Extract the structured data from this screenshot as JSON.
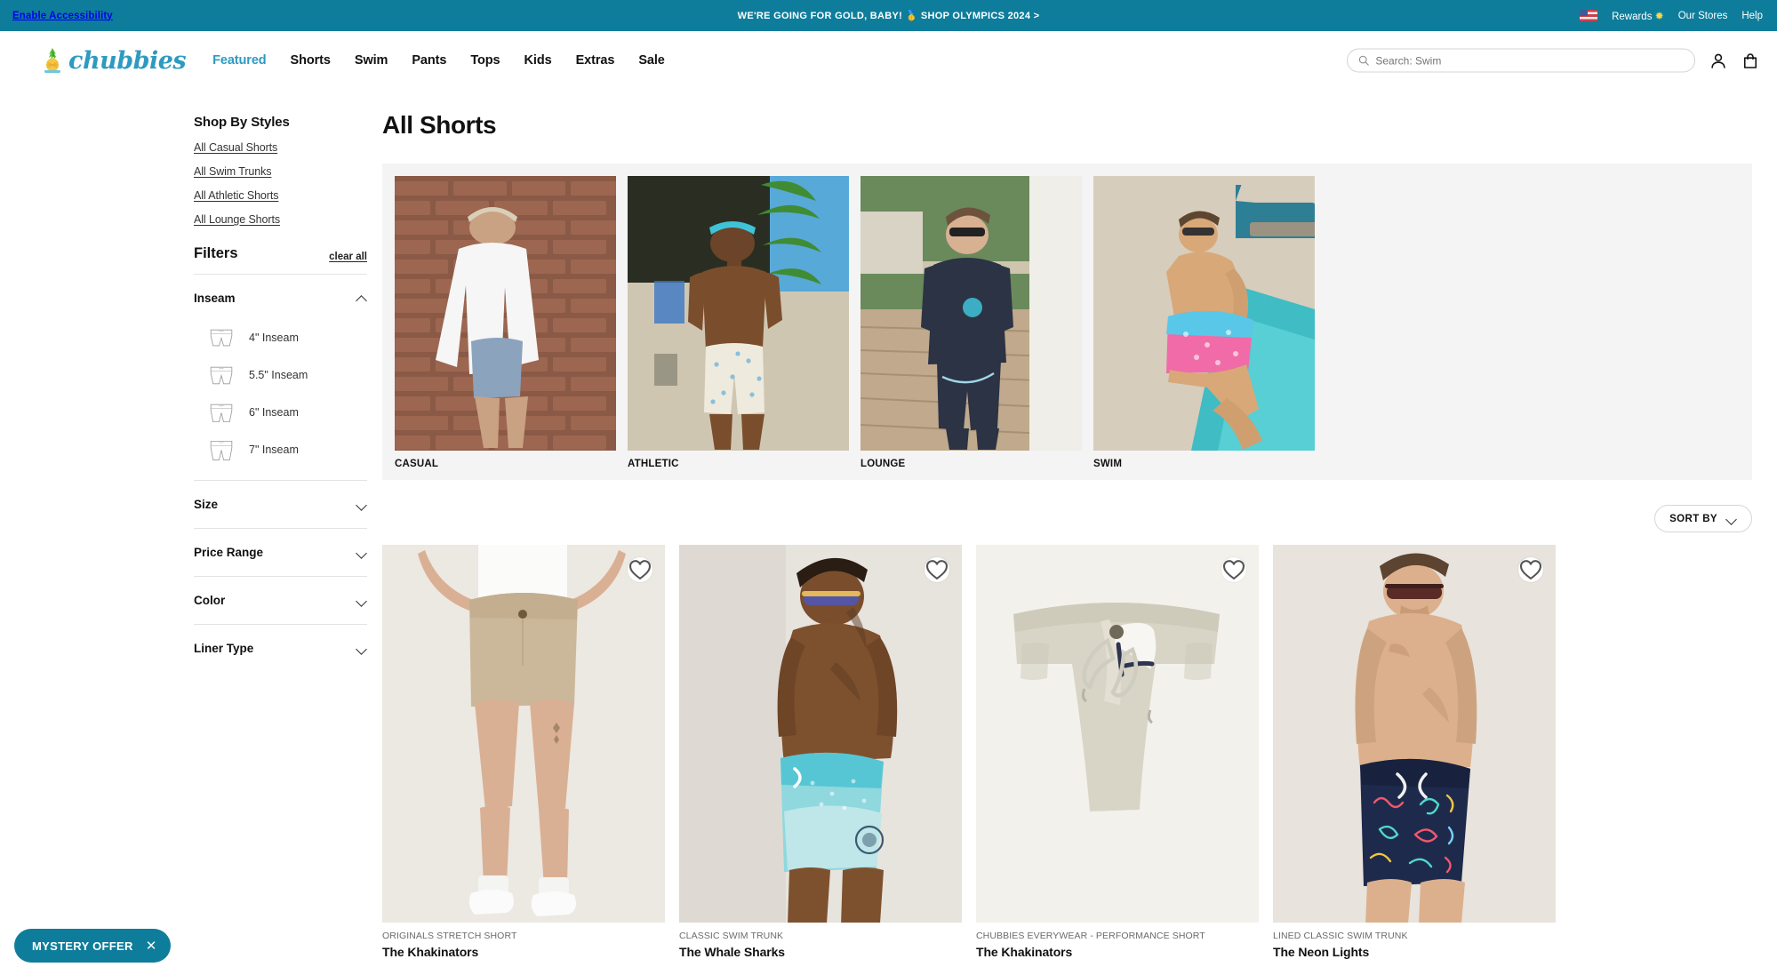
{
  "announcement": {
    "accessibility_label": "Enable Accessibility",
    "promo_text": "WE'RE GOING FOR GOLD, BABY!",
    "promo_link": "SHOP OLYMPICS 2024 >",
    "rewards_label": "Rewards",
    "stores_label": "Our Stores",
    "help_label": "Help",
    "bg_color": "#0e7d9b"
  },
  "header": {
    "brand": "chubbies",
    "nav": [
      {
        "label": "Featured",
        "active": true
      },
      {
        "label": "Shorts",
        "active": false
      },
      {
        "label": "Swim",
        "active": false
      },
      {
        "label": "Pants",
        "active": false
      },
      {
        "label": "Tops",
        "active": false
      },
      {
        "label": "Kids",
        "active": false
      },
      {
        "label": "Extras",
        "active": false
      },
      {
        "label": "Sale",
        "active": false
      }
    ],
    "search": {
      "placeholder": "Search: Swim",
      "value": ""
    },
    "accent_color": "#2e9ac0"
  },
  "sidebar": {
    "styles_heading": "Shop By Styles",
    "style_links": [
      "All Casual Shorts",
      "All Swim Trunks",
      "All Athletic Shorts",
      "All Lounge Shorts"
    ],
    "filters_title": "Filters",
    "clear_all": "clear all",
    "facets": [
      {
        "name": "Inseam",
        "expanded": true,
        "options": [
          "4\" Inseam",
          "5.5\" Inseam",
          "6\" Inseam",
          "7\" Inseam"
        ]
      },
      {
        "name": "Size",
        "expanded": false,
        "options": []
      },
      {
        "name": "Price Range",
        "expanded": false,
        "options": []
      },
      {
        "name": "Color",
        "expanded": false,
        "options": []
      },
      {
        "name": "Liner Type",
        "expanded": false,
        "options": []
      }
    ]
  },
  "main": {
    "page_title": "All Shorts",
    "categories": [
      {
        "label": "CASUAL"
      },
      {
        "label": "ATHLETIC"
      },
      {
        "label": "LOUNGE"
      },
      {
        "label": "SWIM"
      }
    ],
    "sort_label": "SORT BY",
    "products": [
      {
        "subtitle": "ORIGINALS STRETCH SHORT",
        "title": "The Khakinators"
      },
      {
        "subtitle": "CLASSIC SWIM TRUNK",
        "title": "The Whale Sharks"
      },
      {
        "subtitle": "CHUBBIES EVERYWEAR - PERFORMANCE SHORT",
        "title": "The Khakinators"
      },
      {
        "subtitle": "LINED CLASSIC SWIM TRUNK",
        "title": "The Neon Lights"
      }
    ]
  },
  "mystery_offer": {
    "label": "MYSTERY OFFER",
    "close": "✕"
  }
}
